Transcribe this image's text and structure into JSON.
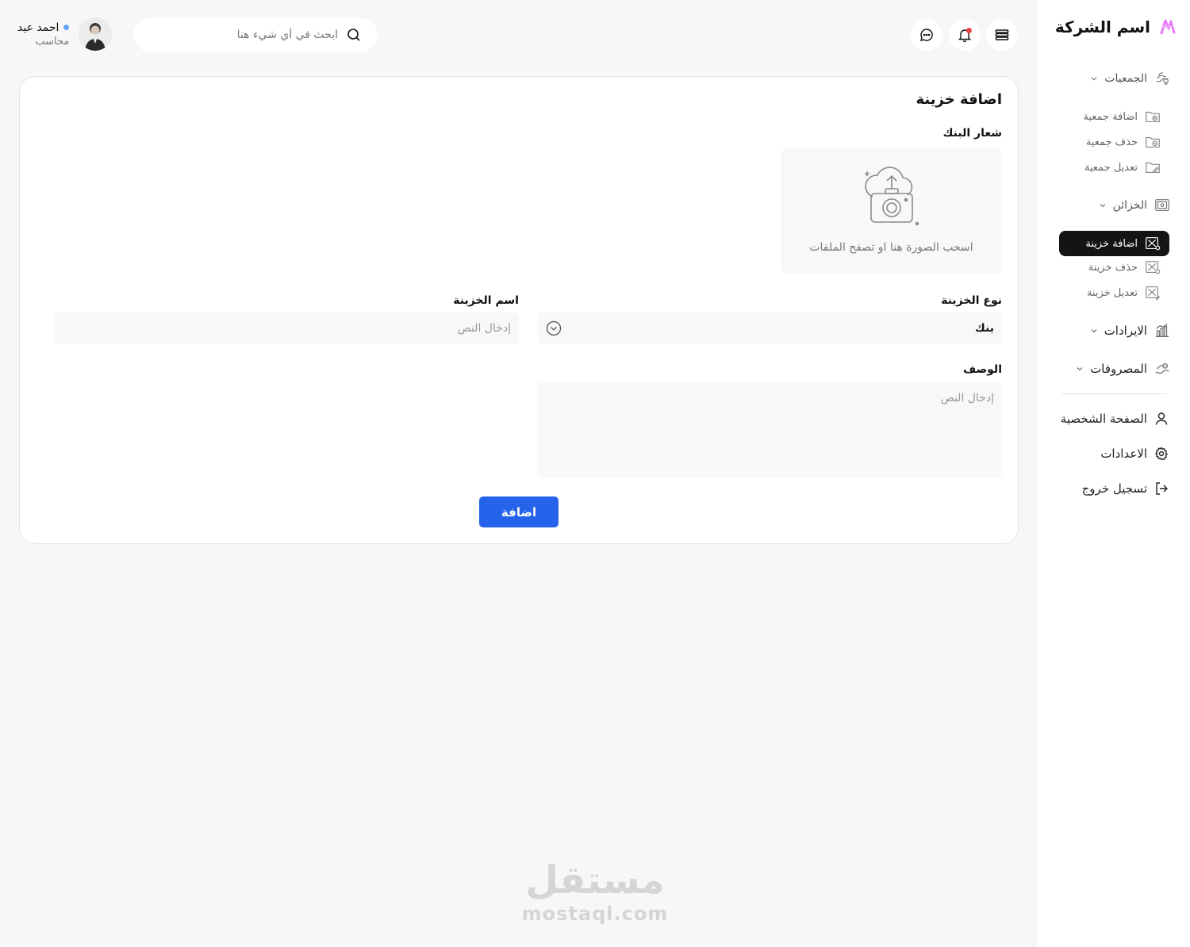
{
  "sidebar": {
    "brand": "اسم الشركة",
    "groups": [
      {
        "label": "الجمعيات",
        "items": [
          "اضافة جمعية",
          "حذف جمعية",
          "تعديل جمعية"
        ]
      },
      {
        "label": "الخزائن",
        "items": [
          "اضافة خزينة",
          "حذف خزينة",
          "تعديل خزينة"
        ],
        "active_item": "اضافة خزينة"
      },
      {
        "label": "الايرادات"
      },
      {
        "label": "المصروفات"
      }
    ],
    "bottom": [
      "الصفحة الشخصية",
      "الاعدادات",
      "تسجيل خروج"
    ]
  },
  "header": {
    "search_placeholder": "ابحث في أي شيء هنا",
    "user_name": "احمد عيد",
    "user_role": "محاسب",
    "icons": [
      "menu-icon",
      "bell-icon",
      "chat-icon",
      "search-icon"
    ]
  },
  "form": {
    "title": "اضافة خزينة",
    "logo_label": "شعار البنك",
    "dropzone_text": "اسحب الصورة هنا او تصفح الملفات",
    "type_label": "نوع الخزينة",
    "type_value": "بنك",
    "name_label": "اسم الخزينة",
    "name_placeholder": "إدخال النص",
    "desc_label": "الوصف",
    "desc_placeholder": "إدخال النص",
    "submit_label": "اضافة"
  },
  "watermark": {
    "arabic": "مستقل",
    "latin": "mostaql.com"
  },
  "colors": {
    "primary": "#2563eb",
    "active_nav": "#141414",
    "background": "#f7f7f7",
    "notification": "#ef4444",
    "online": "#60a5fa"
  }
}
